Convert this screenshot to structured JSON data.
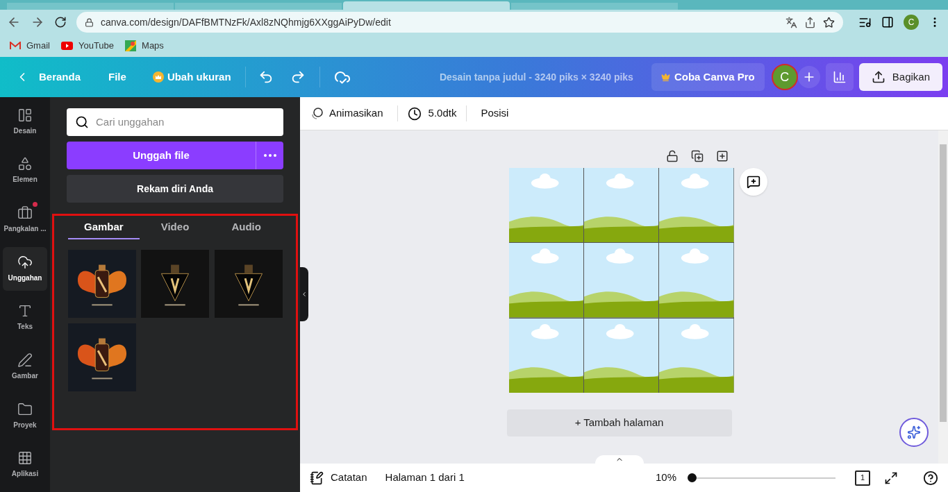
{
  "browser": {
    "tabs": [
      {
        "selected": false
      },
      {
        "selected": false
      },
      {
        "selected": true
      },
      {
        "selected": false
      }
    ],
    "address": "canva.com/design/DAFfBMTNzFk/Axl8zNQhmjg6XXggAiPyDw/edit",
    "profile": "C",
    "bookmarks": [
      {
        "kind": "gmail",
        "label": "Gmail"
      },
      {
        "kind": "youtube",
        "label": "YouTube"
      },
      {
        "kind": "maps",
        "label": "Maps"
      }
    ]
  },
  "header": {
    "back": "Beranda",
    "file": "File",
    "resize": "Ubah ukuran",
    "title": "Desain tanpa judul - 3240 piks × 3240 piks",
    "pro": "Coba Canva Pro",
    "avatar": "C",
    "share": "Bagikan"
  },
  "rail": [
    {
      "kind": "design",
      "label": "Desain",
      "selected": false,
      "badge": false
    },
    {
      "kind": "elements",
      "label": "Elemen",
      "selected": false,
      "badge": false
    },
    {
      "kind": "brand",
      "label": "Pangkalan ...",
      "selected": false,
      "badge": true
    },
    {
      "kind": "upload",
      "label": "Unggahan",
      "selected": true,
      "badge": false
    },
    {
      "kind": "text",
      "label": "Teks",
      "selected": false,
      "badge": false
    },
    {
      "kind": "draw",
      "label": "Gambar",
      "selected": false,
      "badge": false
    },
    {
      "kind": "folder",
      "label": "Proyek",
      "selected": false,
      "badge": false
    },
    {
      "kind": "apps",
      "label": "Aplikasi",
      "selected": false,
      "badge": false
    }
  ],
  "panel": {
    "search": {
      "placeholder": "Cari unggahan"
    },
    "upload": "Unggah file",
    "record": "Rekam diri Anda",
    "highlighted": true,
    "tabs": [
      {
        "label": "Gambar",
        "selected": true
      },
      {
        "label": "Video",
        "selected": false
      },
      {
        "label": "Audio",
        "selected": false
      }
    ]
  },
  "toolbar": {
    "animate": "Animasikan",
    "duration": "5.0dtk",
    "position": "Posisi"
  },
  "design": {
    "add_page": "+ Tambah halaman"
  },
  "footer": {
    "notes": "Catatan",
    "page": "Halaman 1 dari 1",
    "zoom": "10%",
    "level": 0,
    "page_count": "1"
  }
}
